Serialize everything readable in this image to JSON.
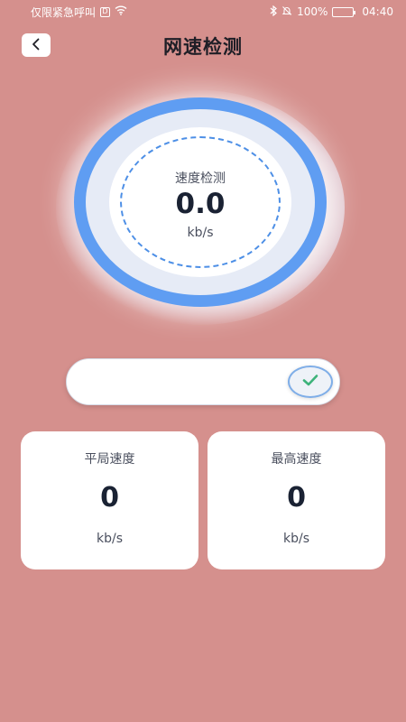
{
  "status_bar": {
    "carrier_text": "仅限紧急呼叫",
    "sim_icon_label": "D",
    "battery_text": "100%",
    "time": "04:40"
  },
  "header": {
    "title": "网速检测",
    "back_icon": "chevron-left-icon"
  },
  "gauge": {
    "label": "速度检测",
    "value": "0.0",
    "unit": "kb/s",
    "ring_color": "#5f9df2"
  },
  "progress": {
    "value_percent": 100,
    "status_icon": "check-icon",
    "check_color": "#3db37a"
  },
  "stats": {
    "average": {
      "title": "平局速度",
      "value": "0",
      "unit": "kb/s"
    },
    "max": {
      "title": "最高速度",
      "value": "0",
      "unit": "kb/s"
    }
  },
  "colors": {
    "background": "#d5908d",
    "accent": "#5f9df2"
  }
}
